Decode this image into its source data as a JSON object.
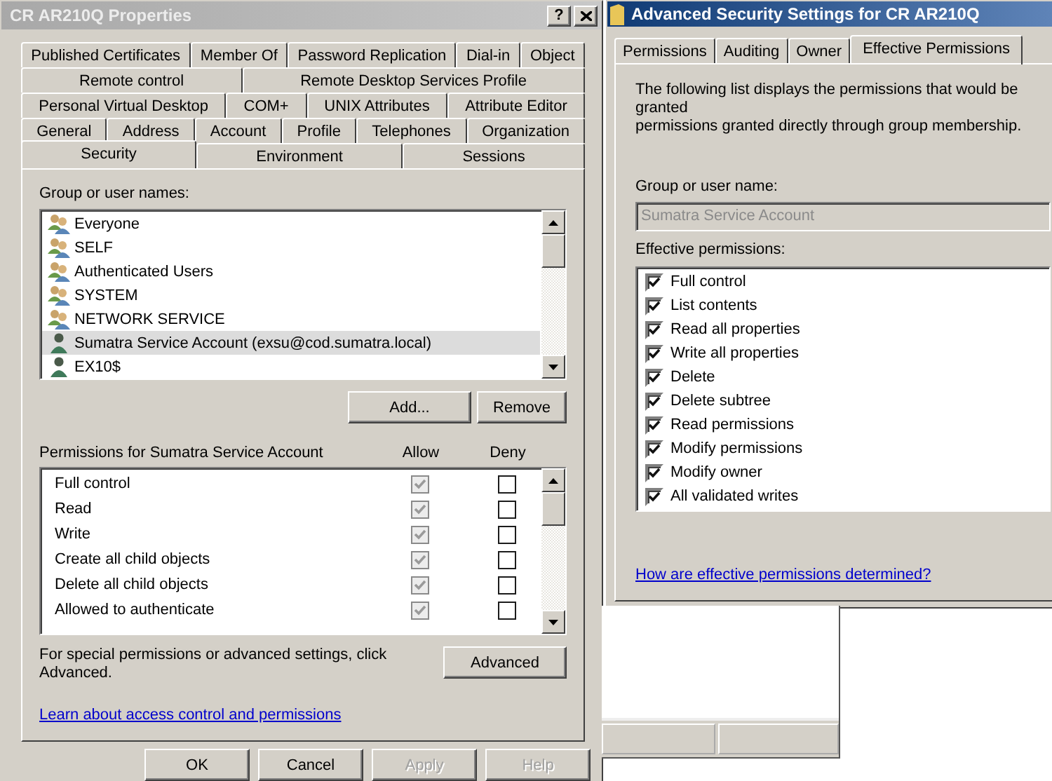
{
  "properties_dialog": {
    "title": "CR AR210Q Properties",
    "help_button": "?",
    "tab_rows": [
      [
        {
          "label": "Published Certificates",
          "selected": false
        },
        {
          "label": "Member Of",
          "selected": false
        },
        {
          "label": "Password Replication",
          "selected": false
        },
        {
          "label": "Dial-in",
          "selected": false
        },
        {
          "label": "Object",
          "selected": false
        }
      ],
      [
        {
          "label": "Remote control",
          "selected": false
        },
        {
          "label": "Remote Desktop Services Profile",
          "selected": false
        }
      ],
      [
        {
          "label": "Personal Virtual Desktop",
          "selected": false
        },
        {
          "label": "COM+",
          "selected": false
        },
        {
          "label": "UNIX Attributes",
          "selected": false
        },
        {
          "label": "Attribute Editor",
          "selected": false
        }
      ],
      [
        {
          "label": "General",
          "selected": false
        },
        {
          "label": "Address",
          "selected": false
        },
        {
          "label": "Account",
          "selected": false
        },
        {
          "label": "Profile",
          "selected": false
        },
        {
          "label": "Telephones",
          "selected": false
        },
        {
          "label": "Organization",
          "selected": false
        }
      ],
      [
        {
          "label": "Security",
          "selected": true
        },
        {
          "label": "Environment",
          "selected": false
        },
        {
          "label": "Sessions",
          "selected": false
        }
      ]
    ],
    "group_label": "Group or user names:",
    "principals": [
      {
        "name": "Everyone",
        "kind": "group",
        "selected": false
      },
      {
        "name": "SELF",
        "kind": "group",
        "selected": false
      },
      {
        "name": "Authenticated Users",
        "kind": "group",
        "selected": false
      },
      {
        "name": "SYSTEM",
        "kind": "group",
        "selected": false
      },
      {
        "name": "NETWORK SERVICE",
        "kind": "group",
        "selected": false
      },
      {
        "name": "Sumatra Service Account (exsu@cod.sumatra.local)",
        "kind": "user",
        "selected": true
      },
      {
        "name": "EX10$",
        "kind": "user",
        "selected": false
      }
    ],
    "principal_buttons": [
      "Add...",
      "Remove"
    ],
    "permissions_label": "Permissions for Sumatra Service Account",
    "allow_label": "Allow",
    "deny_label": "Deny",
    "permissions": [
      {
        "name": "Full control",
        "allow": true,
        "allow_disabled": true,
        "deny": false
      },
      {
        "name": "Read",
        "allow": true,
        "allow_disabled": true,
        "deny": false
      },
      {
        "name": "Write",
        "allow": true,
        "allow_disabled": true,
        "deny": false
      },
      {
        "name": "Create all child objects",
        "allow": true,
        "allow_disabled": true,
        "deny": false
      },
      {
        "name": "Delete all child objects",
        "allow": true,
        "allow_disabled": true,
        "deny": false
      },
      {
        "name": "Allowed to authenticate",
        "allow": true,
        "allow_disabled": true,
        "deny": false
      }
    ],
    "advanced_note": "For special permissions or advanced settings, click Advanced.",
    "advanced_button": "Advanced",
    "help_link": "Learn about access control and permissions",
    "buttons": [
      {
        "label": "OK",
        "disabled": false
      },
      {
        "label": "Cancel",
        "disabled": false
      },
      {
        "label": "Apply",
        "disabled": true
      },
      {
        "label": "Help",
        "disabled": true
      }
    ]
  },
  "advanced_dialog": {
    "title": "Advanced Security Settings for CR AR210Q",
    "tabs": [
      {
        "label": "Permissions",
        "selected": false
      },
      {
        "label": "Auditing",
        "selected": false
      },
      {
        "label": "Owner",
        "selected": false
      },
      {
        "label": "Effective Permissions",
        "selected": true
      }
    ],
    "description_lines": [
      "The following list displays the permissions that would be granted",
      "permissions granted directly through group membership."
    ],
    "user_label": "Group or user name:",
    "user_value": "Sumatra Service Account",
    "effective_label": "Effective permissions:",
    "effective_permissions": [
      {
        "name": "Full control",
        "checked": true
      },
      {
        "name": "List contents",
        "checked": true
      },
      {
        "name": "Read all properties",
        "checked": true
      },
      {
        "name": "Write all properties",
        "checked": true
      },
      {
        "name": "Delete",
        "checked": true
      },
      {
        "name": "Delete subtree",
        "checked": true
      },
      {
        "name": "Read permissions",
        "checked": true
      },
      {
        "name": "Modify permissions",
        "checked": true
      },
      {
        "name": "Modify owner",
        "checked": true
      },
      {
        "name": "All validated writes",
        "checked": true
      }
    ],
    "help_link": "How are effective permissions determined?"
  }
}
